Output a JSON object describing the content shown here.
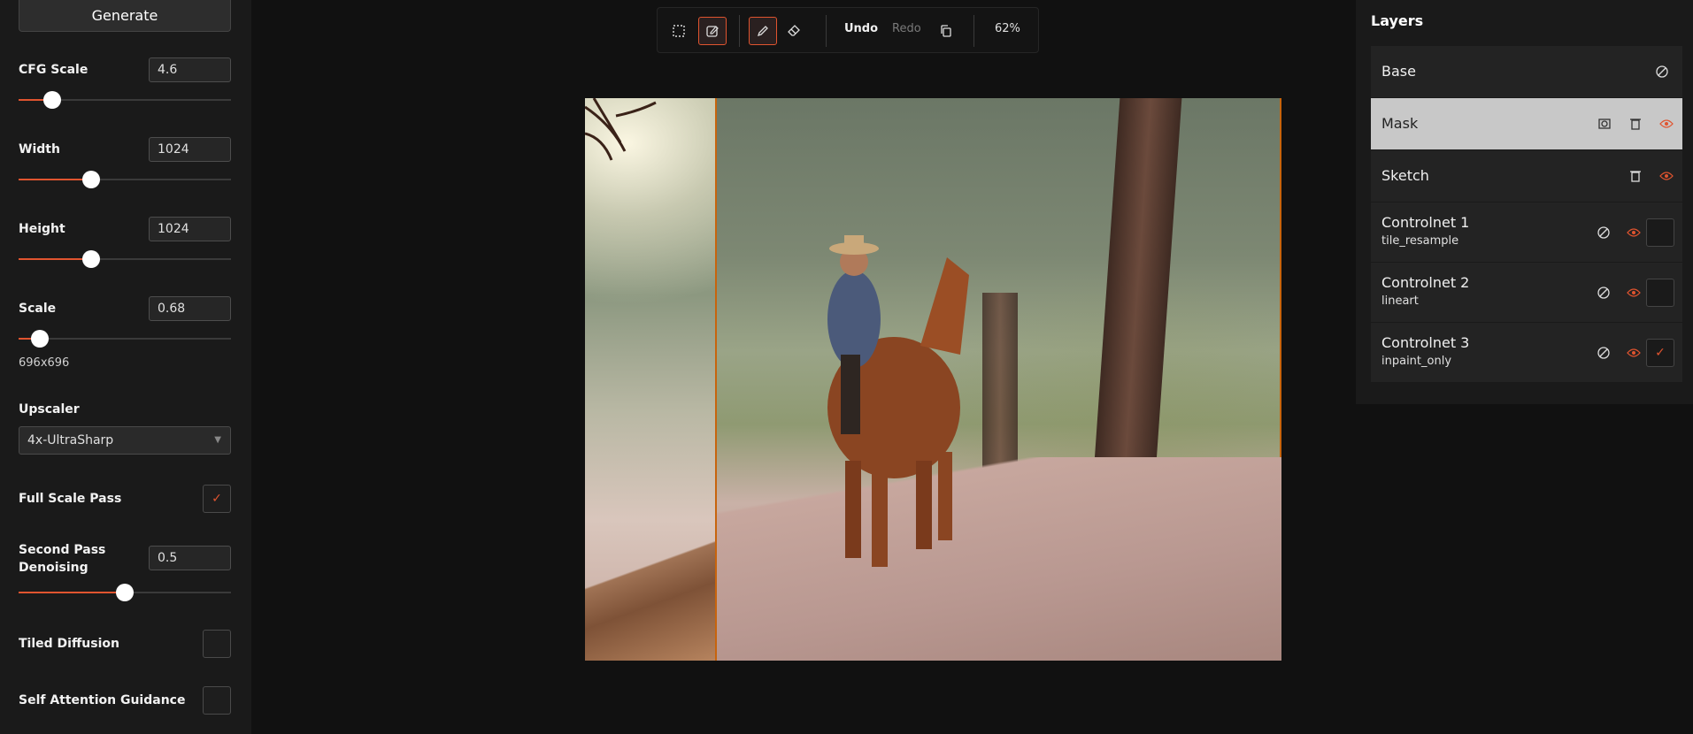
{
  "left_panel": {
    "generate_label": "Generate",
    "cfg": {
      "label": "CFG Scale",
      "value": "4.6",
      "slider_fraction": 0.16
    },
    "width": {
      "label": "Width",
      "value": "1024",
      "slider_fraction": 0.34
    },
    "height": {
      "label": "Height",
      "value": "1024",
      "slider_fraction": 0.34
    },
    "scale": {
      "label": "Scale",
      "value": "0.68",
      "slider_fraction": 0.1,
      "resolution": "696x696"
    },
    "upscaler": {
      "label": "Upscaler",
      "selected": "4x-UltraSharp"
    },
    "full_scale_pass": {
      "label": "Full Scale Pass",
      "checked": true,
      "mark": "✓"
    },
    "second_pass": {
      "label_line1": "Second Pass",
      "label_line2": "Denoising",
      "value": "0.5",
      "slider_fraction": 0.5
    },
    "tiled_diffusion": {
      "label": "Tiled Diffusion",
      "checked": false
    },
    "self_attention": {
      "label": "Self Attention Guidance",
      "checked": false
    }
  },
  "toolbar": {
    "undo_label": "Undo",
    "redo_label": "Redo",
    "zoom": "62%",
    "tools": [
      "selection-icon",
      "edit-icon",
      "pencil-icon",
      "eraser-icon",
      "copy-icon"
    ]
  },
  "layers": {
    "title": "Layers",
    "items": [
      {
        "name": "Base"
      },
      {
        "name": "Mask"
      },
      {
        "name": "Sketch"
      },
      {
        "name": "Controlnet 1",
        "sub": "tile_resample"
      },
      {
        "name": "Controlnet 2",
        "sub": "lineart"
      },
      {
        "name": "Controlnet 3",
        "sub": "inpaint_only",
        "check_mark": "✓"
      }
    ]
  },
  "colors": {
    "accent": "#e0542f",
    "selection_border": "#c7640d",
    "panel_bg": "#1a1a1a",
    "app_bg": "#111111"
  }
}
